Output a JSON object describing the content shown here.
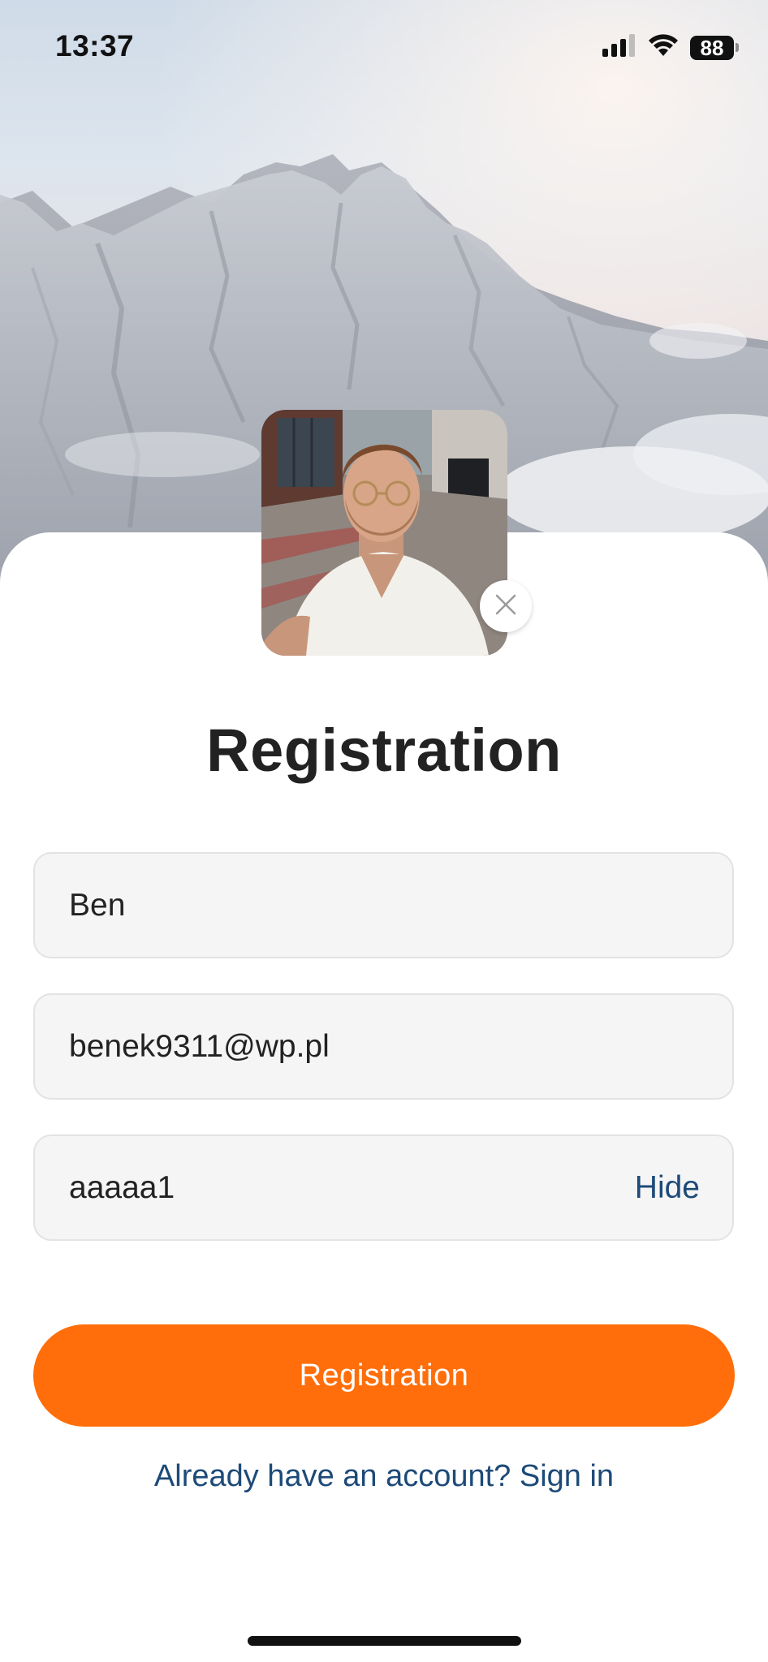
{
  "status_bar": {
    "time": "13:37",
    "battery_level": "88"
  },
  "title": "Registration",
  "form": {
    "name_value": "Ben",
    "email_value": "benek9311@wp.pl",
    "password_value": "aaaaa1",
    "password_toggle_label": "Hide"
  },
  "actions": {
    "register_label": "Registration",
    "signin_prompt": "Already have an account? Sign in"
  },
  "icons": {
    "signal": "cellular-signal-icon",
    "wifi": "wifi-icon",
    "battery": "battery-icon",
    "remove_photo": "close-icon"
  },
  "colors": {
    "accent": "#ff6e0a",
    "link": "#1d4a78",
    "field_background": "#f5f5f5",
    "title_text": "#222222"
  }
}
